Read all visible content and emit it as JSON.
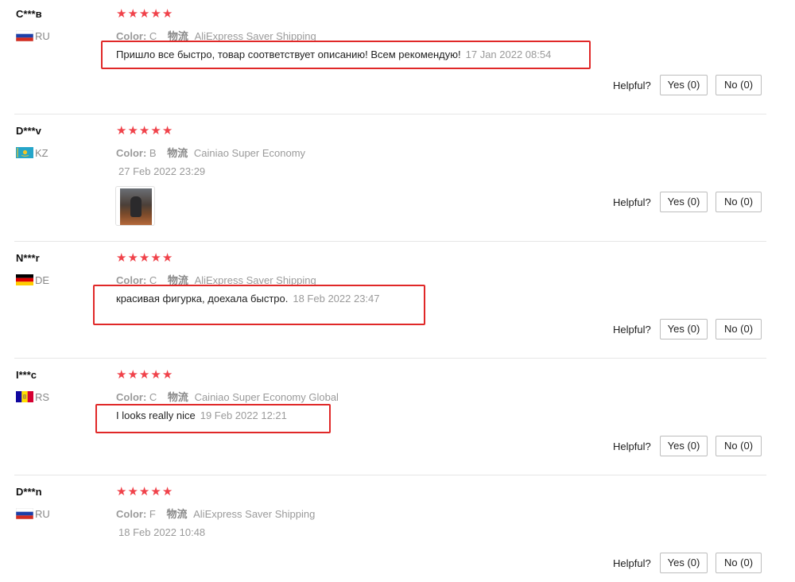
{
  "common": {
    "color_label": "Color:",
    "shipping_label": "物流",
    "helpful_label": "Helpful?",
    "yes_label": "Yes (0)",
    "no_label": "No (0)",
    "star_glyph": "★"
  },
  "reviews": [
    {
      "user": "C***в",
      "country": "RU",
      "flag": "russia-flag-icon",
      "rating": 5,
      "color": "C",
      "shipping": "AliExpress Saver Shipping",
      "text": "Пришло все быстро, товар соответствует описанию! Всем рекомендую!",
      "date": "17 Jan 2022 08:54",
      "highlighted": true
    },
    {
      "user": "D***v",
      "country": "KZ",
      "flag": "kazakhstan-flag-icon",
      "rating": 5,
      "color": "B",
      "shipping": "Cainiao Super Economy",
      "text": "",
      "date": "27 Feb 2022 23:29",
      "photos": [
        "review-photo-thumbnail"
      ]
    },
    {
      "user": "N***r",
      "country": "DE",
      "flag": "germany-flag-icon",
      "rating": 5,
      "color": "C",
      "shipping": "AliExpress Saver Shipping",
      "text": "красивая фигурка, доехала быстро.",
      "date": "18 Feb 2022 23:47",
      "highlighted": true
    },
    {
      "user": "I***c",
      "country": "RS",
      "flag": "andorra-flag-icon",
      "rating": 5,
      "color": "C",
      "shipping": "Cainiao Super Economy Global",
      "text": "I looks really nice",
      "date": "19 Feb 2022 12:21",
      "highlighted": true
    },
    {
      "user": "D***n",
      "country": "RU",
      "flag": "russia-flag-icon",
      "rating": 5,
      "color": "F",
      "shipping": "AliExpress Saver Shipping",
      "text": "",
      "date": "18 Feb 2022 10:48"
    }
  ],
  "colors": {
    "star": "#f0424a",
    "highlight_border": "#e02828",
    "meta_text": "#9a9a9a"
  }
}
